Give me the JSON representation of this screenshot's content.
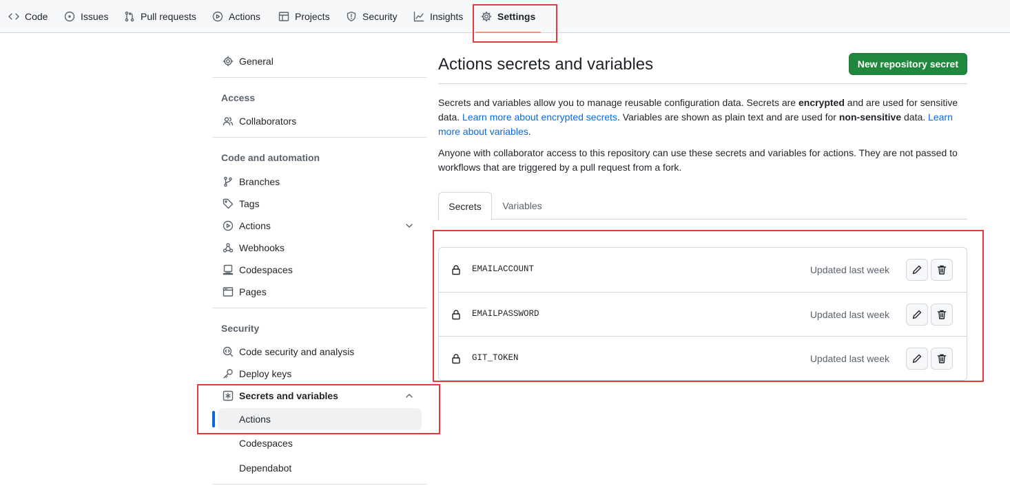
{
  "repo_nav": {
    "tabs": [
      {
        "label": "Code",
        "icon": "code-icon"
      },
      {
        "label": "Issues",
        "icon": "issue-opened-icon"
      },
      {
        "label": "Pull requests",
        "icon": "git-pull-request-icon"
      },
      {
        "label": "Actions",
        "icon": "play-icon"
      },
      {
        "label": "Projects",
        "icon": "table-icon"
      },
      {
        "label": "Security",
        "icon": "shield-icon"
      },
      {
        "label": "Insights",
        "icon": "graph-icon"
      },
      {
        "label": "Settings",
        "icon": "gear-icon",
        "active": true
      }
    ]
  },
  "sidebar": {
    "general": "General",
    "access": {
      "heading": "Access",
      "collaborators": "Collaborators"
    },
    "code_automation": {
      "heading": "Code and automation",
      "branches": "Branches",
      "tags": "Tags",
      "actions": "Actions",
      "webhooks": "Webhooks",
      "codespaces": "Codespaces",
      "pages": "Pages"
    },
    "security": {
      "heading": "Security",
      "code_security": "Code security and analysis",
      "deploy_keys": "Deploy keys",
      "secrets_variables": "Secrets and variables",
      "sub_actions": "Actions",
      "sub_codespaces": "Codespaces",
      "sub_dependabot": "Dependabot"
    }
  },
  "main": {
    "title": "Actions secrets and variables",
    "new_secret_button": "New repository secret",
    "desc1": {
      "p1": "Secrets and variables allow you to manage reusable configuration data. Secrets are ",
      "b1": "encrypted",
      "p2": " and are used for sensitive data. ",
      "link1": "Learn more about encrypted secrets",
      "p3": ". Variables are shown as plain text and are used for ",
      "b2": "non-sensitive",
      "p4": " data. ",
      "link2": "Learn more about variables",
      "p5": "."
    },
    "desc2": "Anyone with collaborator access to this repository can use these secrets and variables for actions. They are not passed to workflows that are triggered by a pull request from a fork.",
    "tabs": {
      "secrets": "Secrets",
      "variables": "Variables"
    },
    "secrets": [
      {
        "name": "EMAILACCOUNT",
        "updated": "Updated last week"
      },
      {
        "name": "EMAILPASSWORD",
        "updated": "Updated last week"
      },
      {
        "name": "GIT_TOKEN",
        "updated": "Updated last week"
      }
    ]
  },
  "colors": {
    "primary_button": "#1f883d",
    "link": "#0969da",
    "annotation_box": "#e5393c",
    "active_tab_underline": "#fd8c73"
  }
}
